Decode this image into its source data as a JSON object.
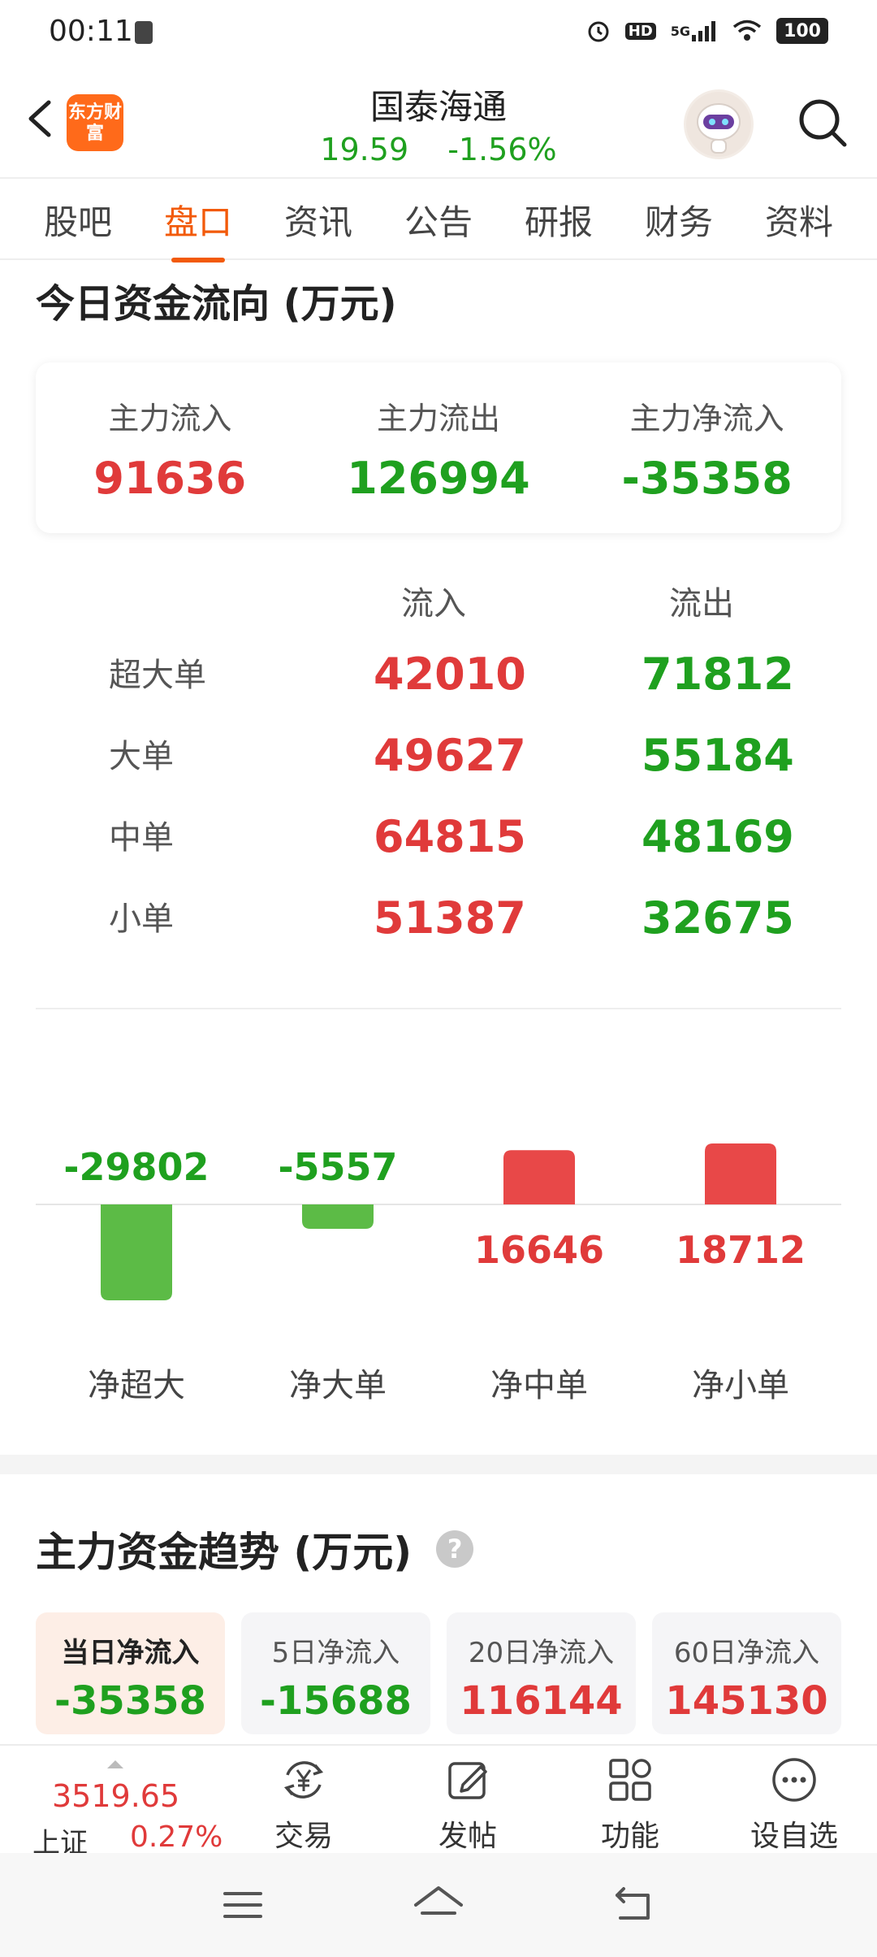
{
  "status_bar": {
    "time": "00:11",
    "signal_label": "5G",
    "hd_label": "HD",
    "battery": "100"
  },
  "header": {
    "logo_text": "东方财富",
    "stock_name": "国泰海通",
    "price": "19.59",
    "change_pct": "-1.56%"
  },
  "tabs": [
    {
      "label": "股吧",
      "active": false
    },
    {
      "label": "盘口",
      "active": true
    },
    {
      "label": "资讯",
      "active": false
    },
    {
      "label": "公告",
      "active": false
    },
    {
      "label": "研报",
      "active": false
    },
    {
      "label": "财务",
      "active": false
    },
    {
      "label": "资料",
      "active": false
    }
  ],
  "fund_flow": {
    "title": "今日资金流向 (万元)",
    "summary": [
      {
        "label": "主力流入",
        "value": "91636",
        "color": "#e03a3a"
      },
      {
        "label": "主力流出",
        "value": "126994",
        "color": "#1fa01f"
      },
      {
        "label": "主力净流入",
        "value": "-35358",
        "color": "#1fa01f"
      }
    ],
    "table_headers": {
      "in": "流入",
      "out": "流出"
    },
    "rows": [
      {
        "label": "超大单",
        "in": "42010",
        "out": "71812"
      },
      {
        "label": "大单",
        "in": "49627",
        "out": "55184"
      },
      {
        "label": "中单",
        "in": "64815",
        "out": "48169"
      },
      {
        "label": "小单",
        "in": "51387",
        "out": "32675"
      }
    ]
  },
  "chart_data": {
    "type": "bar",
    "categories": [
      "净超大",
      "净大单",
      "净中单",
      "净小单"
    ],
    "values": [
      -29802,
      -5557,
      16646,
      18712
    ],
    "data_labels": [
      "-29802",
      "-5557",
      "16646",
      "18712"
    ],
    "positive_color": "#e84848",
    "negative_color": "#5cbb46",
    "title": "",
    "xlabel": "",
    "ylabel": ""
  },
  "trend": {
    "title": "主力资金趋势 (万元)",
    "help_icon": "question-icon",
    "cards": [
      {
        "label": "当日净流入",
        "value": "-35358",
        "color": "#1fa01f",
        "active": true
      },
      {
        "label": "5日净流入",
        "value": "-15688",
        "color": "#1fa01f",
        "active": false
      },
      {
        "label": "20日净流入",
        "value": "116144",
        "color": "#e03a3a",
        "active": false
      },
      {
        "label": "60日净流入",
        "value": "145130",
        "color": "#e03a3a",
        "active": false
      }
    ]
  },
  "bottom_bar": {
    "index_value": "3519.65",
    "index_name": "上证",
    "index_change": "0.27%",
    "buttons": [
      {
        "label": "交易",
        "icon": "yen-exchange-icon"
      },
      {
        "label": "发帖",
        "icon": "edit-icon"
      },
      {
        "label": "功能",
        "icon": "grid-icon"
      },
      {
        "label": "设自选",
        "icon": "more-icon"
      }
    ]
  }
}
